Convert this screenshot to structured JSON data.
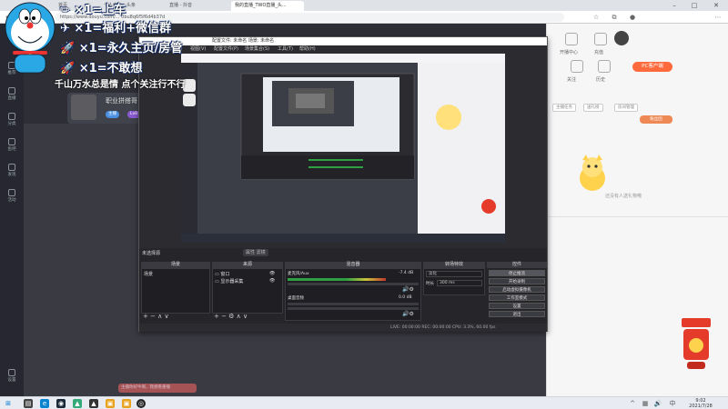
{
  "browser": {
    "tabs": [
      {
        "label": "首页",
        "active": false
      },
      {
        "label": "个人中心 - 头条",
        "active": false
      },
      {
        "label": "直播 - 抖音",
        "active": false
      },
      {
        "label": "我的直播_TWO直播_头...",
        "active": true
      }
    ],
    "url": "https://www.douyu.com/... 0bu8q6f5f6d4b37d"
  },
  "site_sidebar": {
    "items": [
      {
        "label": "推荐"
      },
      {
        "label": "直播"
      },
      {
        "label": "分类"
      },
      {
        "label": "鱼吧"
      },
      {
        "label": "发现"
      },
      {
        "label": "活动"
      },
      {
        "label": "设置"
      }
    ]
  },
  "overlay": {
    "captions": [
      "×1=上车",
      "×1=福利+微信群",
      "×1=永久主页/房管",
      "×1=不敢想"
    ],
    "bottom_caption": "千山万水总是情  点个关注行不行"
  },
  "streamer": {
    "name": "职业拼搭哥",
    "badge1": "主播",
    "badge2": "Lv8"
  },
  "chat": {
    "message": "主播你好牛啊，我想看重播"
  },
  "right_col": {
    "icons": [
      "开播中心",
      "充值",
      "关注",
      "历史"
    ],
    "pc_button": "PC客户端",
    "tabs": [
      "主播任务",
      "送礼榜",
      "房间管理"
    ],
    "gift_button": "粉丝团",
    "empty_text": "还没有人送礼物哦"
  },
  "obs": {
    "title": "配置文件: 未命名  场景: 未命名",
    "menu": [
      "文件(F)",
      "编辑(E)",
      "视图(V)",
      "配置文件(P)",
      "场景集合(S)",
      "工具(T)",
      "帮助(H)"
    ],
    "scenes_title": "场景",
    "sources_title": "来源",
    "mixer_title": "混音器",
    "transitions_title": "转场特效",
    "controls_title": "控件",
    "scene_label_top": "未选择源",
    "source_tabs": "属性  滤镜",
    "scenes": [
      "场景"
    ],
    "sources": [
      "窗口",
      "显示器采集"
    ],
    "mixer": [
      {
        "name": "麦克风/Aux",
        "db": "-7.4 dB",
        "level": 0.75
      },
      {
        "name": "桌面音频",
        "db": "0.0 dB",
        "level": 0.0
      }
    ],
    "transition": "淡化",
    "duration_label": "时长",
    "duration": "300 ms",
    "controls": [
      "停止推流",
      "开始录制",
      "启动虚拟摄像机",
      "工作室模式",
      "设置",
      "退出"
    ],
    "status": "LIVE: 00:00:00   REC: 00:00:00   CPU: 3.3%, 60.00 fps"
  },
  "taskbar": {
    "time": "9:02",
    "date": "2021/7/28"
  },
  "colors": {
    "accent": "#ff6a3d",
    "obs_bg": "#2b2b30",
    "sidebar_bg": "#262730"
  }
}
